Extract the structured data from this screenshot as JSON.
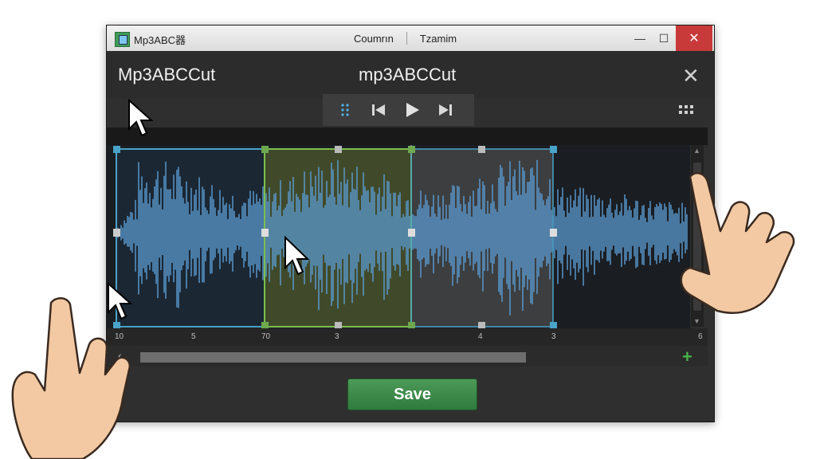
{
  "titlebar": {
    "app_title": "Mp3ABC器",
    "menu": [
      "Coumrın",
      "Tzamim"
    ],
    "min_label": "—",
    "max_label": "☐",
    "close_label": "✕"
  },
  "header": {
    "left_title": "Mp3ABCCut",
    "center_title": "mp3ABCCut",
    "close_label": "✕"
  },
  "transport": {
    "icons": [
      "drag-handle-icon",
      "skip-back-icon",
      "play-icon",
      "skip-forward-icon"
    ]
  },
  "timeline": {
    "ticks": [
      "10",
      "5",
      "70",
      "3",
      "4",
      "3",
      "6"
    ]
  },
  "selection": {
    "regions": [
      {
        "name": "left-region",
        "color": "#4aa3c8"
      },
      {
        "name": "selected-region",
        "color": "#6ea84f"
      },
      {
        "name": "right-region",
        "color": "#9a9a9a"
      }
    ]
  },
  "colors": {
    "waveform": "#5b9bd0",
    "selection_highlight": "#6ea84f",
    "save_button": "#3a8a46",
    "window_bg": "#2f2f2f"
  },
  "save_button": {
    "label": "Save"
  }
}
